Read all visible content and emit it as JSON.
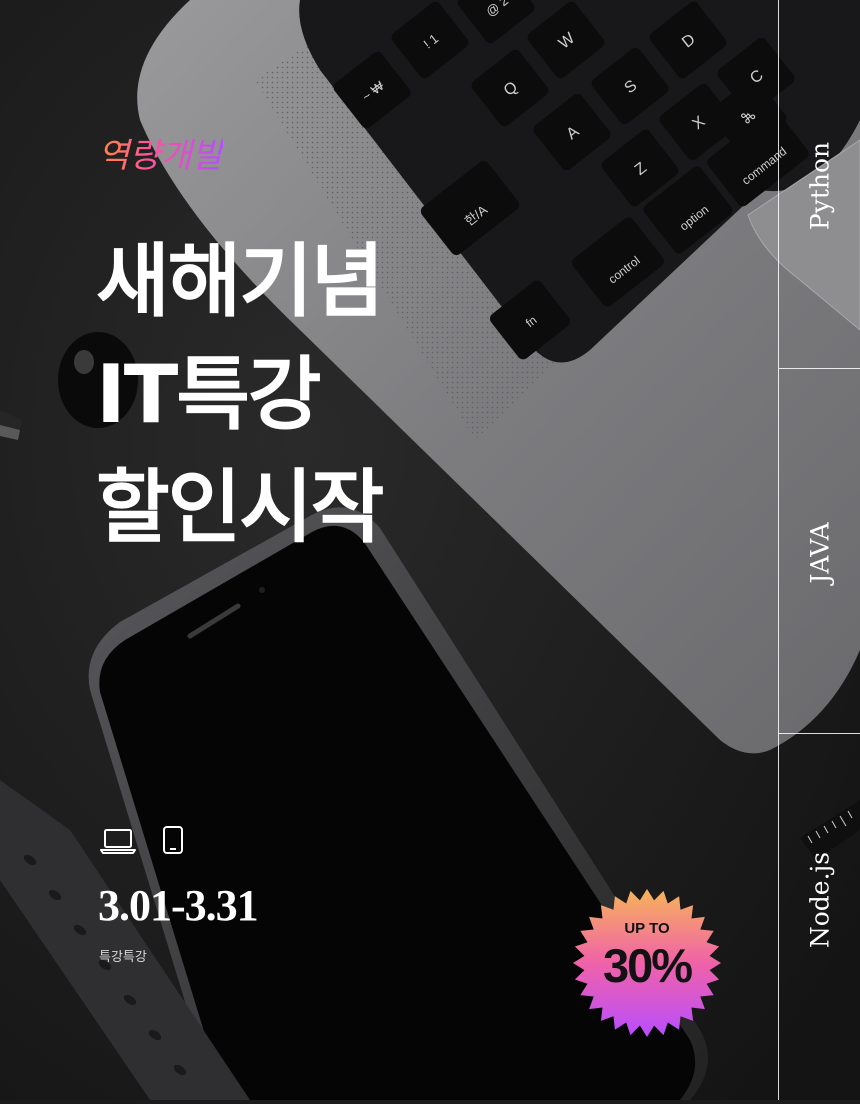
{
  "poster": {
    "kicker": "역량개발",
    "headline": [
      "새해기념",
      "IT특강",
      "할인시작"
    ],
    "device_icons": [
      "laptop-icon",
      "tablet-icon"
    ],
    "date_range": "3.01-3.31",
    "subtitle": "특강특강"
  },
  "side_rail": {
    "labels": [
      "Python",
      "JAVA",
      "Node.js"
    ]
  },
  "badge": {
    "top_text": "UP TO",
    "amount": "30%"
  },
  "keyboard_keys": {
    "labels": [
      "fn",
      "control",
      "option",
      "command",
      "한/A",
      "⌘",
      "~ ₩",
      "! 1",
      "@ 2",
      "Q",
      "W",
      "A",
      "S",
      "D",
      "Z",
      "X",
      "C"
    ]
  },
  "colors": {
    "background": "#1c1c1c",
    "text": "#ffffff",
    "badge_gradient_top": "#f7b45a",
    "badge_gradient_mid": "#f062a8",
    "badge_gradient_bottom": "#b84dff"
  }
}
